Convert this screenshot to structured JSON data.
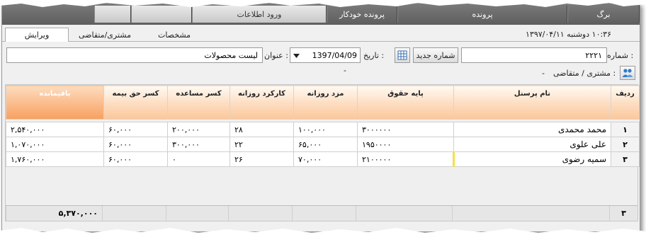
{
  "menu": {
    "items": [
      {
        "label": "برگ",
        "light": false
      },
      {
        "label": "پرونده",
        "light": false
      },
      {
        "label": "پرونده خودکار",
        "light": false
      },
      {
        "label": "ورود اطلاعات",
        "light": true
      },
      {
        "label": "",
        "light": true
      },
      {
        "label": "",
        "light": true
      }
    ]
  },
  "tabs": {
    "edit": "ویرایش",
    "customer": "مشتری/متقاضی",
    "specs": "مشخصات"
  },
  "clock": "۱۰:۳۶   دوشنبه ۱۳۹۷/۰۴/۱۱",
  "form": {
    "number_label": ": شماره",
    "number_value": "۲۲۲۱",
    "new_number_button": "شماره جدید",
    "date_label": ": تاریخ",
    "date_value": "1397/04/09",
    "title_label": ": عنوان",
    "title_value": "لیست محصولات",
    "customer_label": ": مشتری / متقاضی",
    "customer_value": "-",
    "dash": "-"
  },
  "table": {
    "headers": {
      "rowno": "ردیف",
      "name": "نام پرسنل",
      "base": "پایه حقوق",
      "daily": "مزد روزانه",
      "days": "کارکرد روزانه",
      "aid": "کسر مساعده",
      "insurance": "کسر حق بیمه",
      "remain": "باقیمانده"
    },
    "rows": [
      {
        "rowno": "۱",
        "name": "محمد محمدی",
        "base": "۳۰۰۰۰۰۰",
        "daily": "۱۰۰,۰۰۰",
        "days": "۲۸",
        "aid": "۲۰۰,۰۰۰",
        "insurance": "۶۰,۰۰۰",
        "remain": "۲,۵۴۰,۰۰۰"
      },
      {
        "rowno": "۲",
        "name": "علی علوی",
        "base": "۱۹۵۰۰۰۰",
        "daily": "۶۵,۰۰۰",
        "days": "۲۲",
        "aid": "۳۰۰,۰۰۰",
        "insurance": "۶۰,۰۰۰",
        "remain": "۱,۰۷۰,۰۰۰"
      },
      {
        "rowno": "۳",
        "name": "سمیه رضوی",
        "base": "۲۱۰۰۰۰۰",
        "daily": "۷۰,۰۰۰",
        "days": "۲۶",
        "aid": "۰",
        "insurance": "۶۰,۰۰۰",
        "remain": "۱,۷۶۰,۰۰۰"
      }
    ],
    "footer": {
      "count": "۳",
      "total": "۵,۳۷۰,۰۰۰"
    }
  },
  "colors": {
    "header_accent": "#fbc79a",
    "remain_header": "#f8a060",
    "selected_row_marker": "#f4e14a"
  },
  "icons": {
    "calendar_button": "grid-calendar-icon",
    "customer": "users-icon",
    "dropdown": "chevron-down-icon"
  }
}
